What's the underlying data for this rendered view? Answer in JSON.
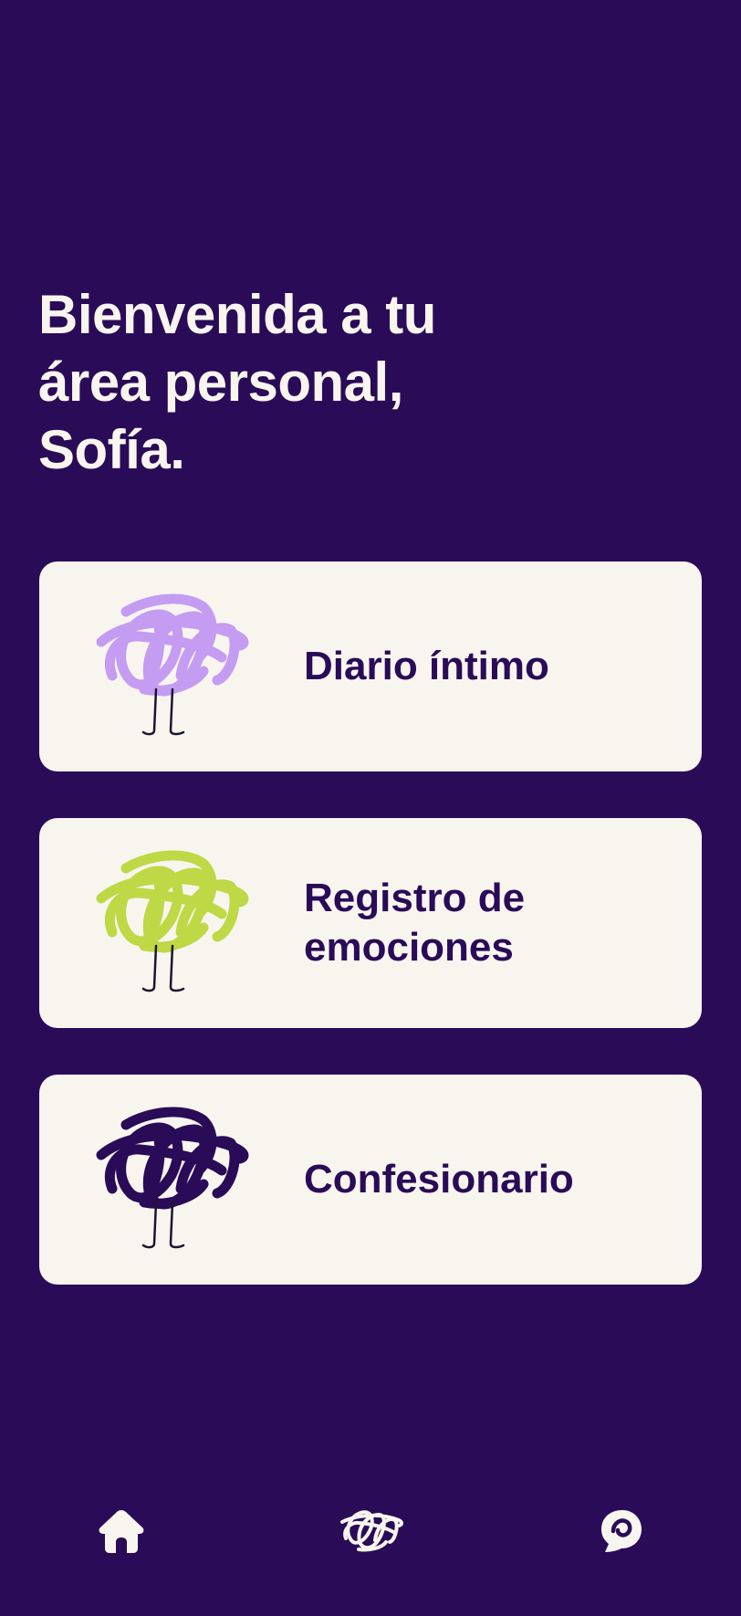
{
  "header": {
    "welcome_line1": "Bienvenida a tu",
    "welcome_line2": "área personal,",
    "welcome_line3": "Sofía."
  },
  "cards": [
    {
      "label_line1": "Diario íntimo",
      "label_line2": "",
      "icon": "lilac-scribble-character-icon",
      "color": "#c49cf2"
    },
    {
      "label_line1": "Registro de",
      "label_line2": "emociones",
      "icon": "lime-scribble-character-icon",
      "color": "#bfd845"
    },
    {
      "label_line1": "Confesionario",
      "label_line2": "",
      "icon": "purple-scribble-character-icon",
      "color": "#2a0b57"
    }
  ],
  "bottom_nav": {
    "items": [
      {
        "icon": "home-icon"
      },
      {
        "icon": "scribble-icon"
      },
      {
        "icon": "chat-swirl-icon"
      }
    ]
  },
  "colors": {
    "background": "#2a0b57",
    "card": "#f8f5ef",
    "text_light": "#f8f5ef",
    "text_dark": "#2a0b57"
  }
}
